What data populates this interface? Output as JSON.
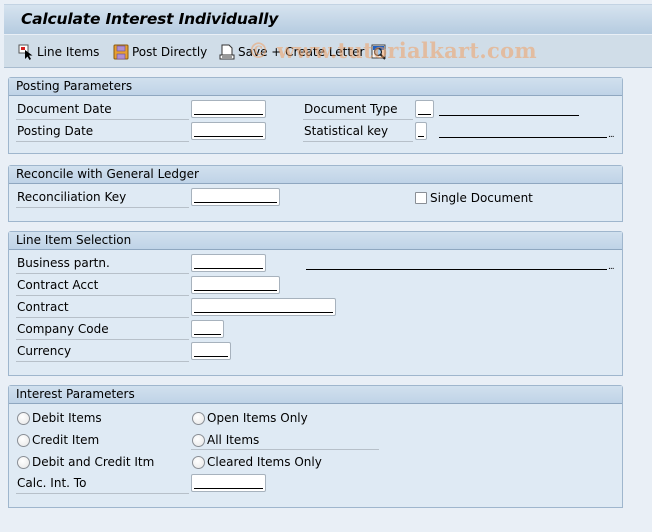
{
  "window": {
    "title": "Calculate Interest Individually"
  },
  "toolbar": {
    "buttons": [
      {
        "label": "Line Items",
        "icon": "line-items-icon"
      },
      {
        "label": "Post Directly",
        "icon": "save-disk-icon"
      },
      {
        "label": "Save + Create Letter",
        "icon": "print-document-icon"
      },
      {
        "label": "",
        "icon": "display-log-icon"
      }
    ]
  },
  "watermark": "© www.tutorialkart.com",
  "groups": {
    "posting_parameters": {
      "title": "Posting Parameters",
      "fields": {
        "document_date": {
          "label": "Document Date",
          "value": ""
        },
        "posting_date": {
          "label": "Posting Date",
          "value": ""
        },
        "document_type": {
          "label": "Document Type",
          "value": "",
          "description": ""
        },
        "statistical_key": {
          "label": "Statistical key",
          "value": "",
          "description": ""
        }
      }
    },
    "reconcile": {
      "title": "Reconcile with General Ledger",
      "fields": {
        "reconciliation_key": {
          "label": "Reconciliation Key",
          "value": ""
        }
      },
      "single_document": {
        "label": "Single Document",
        "checked": false
      }
    },
    "line_item_selection": {
      "title": "Line Item Selection",
      "fields": {
        "business_partner": {
          "label": "Business partn.",
          "value": "",
          "description": ""
        },
        "contract_account": {
          "label": "Contract Acct",
          "value": ""
        },
        "contract": {
          "label": "Contract",
          "value": ""
        },
        "company_code": {
          "label": "Company Code",
          "value": ""
        },
        "currency": {
          "label": "Currency",
          "value": ""
        }
      }
    },
    "interest_parameters": {
      "title": "Interest Parameters",
      "item_type_options": [
        {
          "label": "Debit Items",
          "selected": false
        },
        {
          "label": "Credit Item",
          "selected": false
        },
        {
          "label": "Debit and Credit Itm",
          "selected": false
        }
      ],
      "item_status_options": [
        {
          "label": "Open Items Only",
          "selected": false
        },
        {
          "label": "All Items",
          "selected": false
        },
        {
          "label": "Cleared Items Only",
          "selected": false
        }
      ],
      "fields": {
        "calc_int_to": {
          "label": "Calc. Int. To",
          "value": ""
        }
      }
    }
  }
}
